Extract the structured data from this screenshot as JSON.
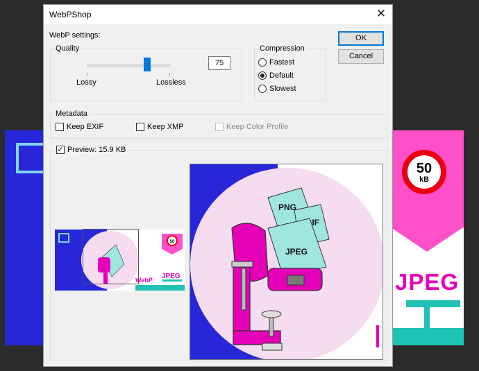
{
  "background": {
    "badge_number": "50",
    "badge_unit": "kB",
    "format_text": "JPEG"
  },
  "dialog": {
    "title": "WebPShop",
    "close_glyph": "✕",
    "section_label": "WebP settings:",
    "ok_label": "OK",
    "cancel_label": "Cancel",
    "quality": {
      "legend": "Quality",
      "value": "75",
      "min_label": "Lossy",
      "max_label": "Lossless"
    },
    "compression": {
      "legend": "Compression",
      "options": [
        "Fastest",
        "Default",
        "Slowest"
      ],
      "selected": "Default"
    },
    "metadata": {
      "legend": "Metadata",
      "keep_exif": "Keep EXIF",
      "keep_xmp": "Keep XMP",
      "keep_color_profile": "Keep Color Profile"
    },
    "preview": {
      "label": "Preview: 15.9 KB",
      "checked": true,
      "check_glyph": "✓"
    },
    "artwork": {
      "file_labels": [
        "PNG",
        "GIF",
        "JPEG"
      ],
      "thumb_labels": [
        "50",
        "kB",
        "WebP",
        "JPEG"
      ]
    }
  },
  "colors": {
    "accent": "#0078d7",
    "blue": "#2727d9",
    "magenta": "#e600b8",
    "pink": "#ff4fc9",
    "teal": "#1ec3b3",
    "red": "#e60012"
  }
}
